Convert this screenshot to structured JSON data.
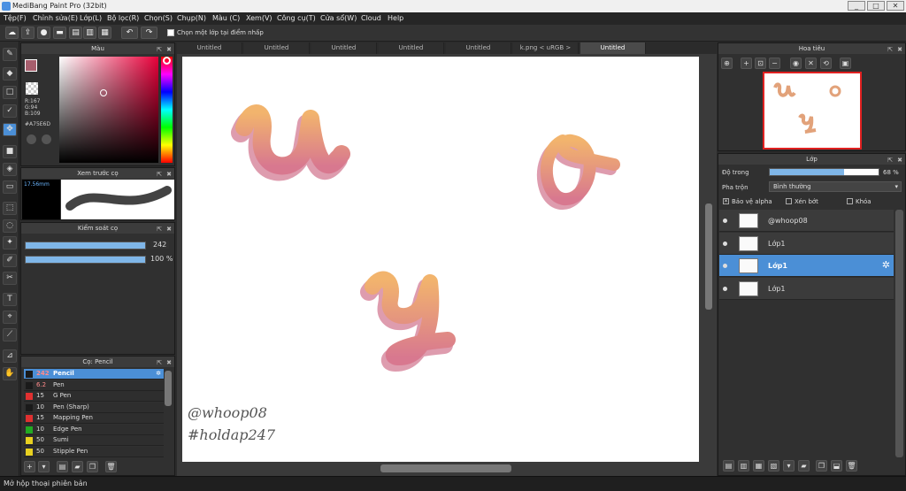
{
  "window": {
    "title": "MediBang Paint Pro (32bit)"
  },
  "menu": [
    "Tệp(F)",
    "Chỉnh sửa(E)",
    "Lớp(L)",
    "Bộ lọc(R)",
    "Chọn(S)",
    "Chụp(N)",
    "Màu (C)",
    "Xem(V)",
    "Công cụ(T)",
    "Cửa sổ(W)",
    "Cloud",
    "Help"
  ],
  "toolbar": {
    "select_layer_label": "Chọn một lớp tại điểm nhấp"
  },
  "color_panel": {
    "title": "Màu",
    "r": "R:167",
    "g": "G:94",
    "b": "B:109",
    "hex": "#A75E6D",
    "primary_color": "#a75e6d"
  },
  "preview_panel": {
    "title": "Xem trước cọ",
    "size": "17.56mm"
  },
  "brush_control": {
    "title": "Kiểm soát cọ",
    "size_value": "242",
    "opacity_value": "100 %",
    "size_fraction": 1.0,
    "opacity_fraction": 1.0
  },
  "brush_panel": {
    "title": "Cọ: Pencil",
    "items": [
      {
        "size": "242",
        "name": "Pencil",
        "color": "#1a1a1a"
      },
      {
        "size": "6.2",
        "name": "Pen",
        "color": "#1a1a1a"
      },
      {
        "size": "15",
        "name": "G Pen",
        "color": "#e03030"
      },
      {
        "size": "10",
        "name": "Pen (Sharp)",
        "color": "#1a1a1a"
      },
      {
        "size": "15",
        "name": "Mapping Pen",
        "color": "#e03030"
      },
      {
        "size": "10",
        "name": "Edge Pen",
        "color": "#22aa22"
      },
      {
        "size": "50",
        "name": "Sumi",
        "color": "#e8d020"
      },
      {
        "size": "50",
        "name": "Stipple Pen",
        "color": "#e8d020"
      }
    ]
  },
  "tabs": [
    "Untitled",
    "Untitled",
    "Untitled",
    "Untitled",
    "Untitled",
    "k.png < uRGB >",
    "Untitled"
  ],
  "canvas": {
    "signature_line1": "@whoop08",
    "signature_line2": "#holdap247"
  },
  "navigator": {
    "title": "Hoa tiêu"
  },
  "layer_panel": {
    "title": "Lớp",
    "opacity_label": "Độ trong",
    "opacity_value": "68 %",
    "opacity_fraction": 0.68,
    "blend_label": "Pha trộn",
    "blend_value": "Bình thường",
    "protect_alpha": "Bảo vệ alpha",
    "clipping": "Xén bớt",
    "lock": "Khóa",
    "layers": [
      "@whoop08",
      "Lớp1",
      "Lớp1",
      "Lớp1"
    ]
  },
  "status": {
    "text": "Mở hộp thoại phiên bản"
  }
}
